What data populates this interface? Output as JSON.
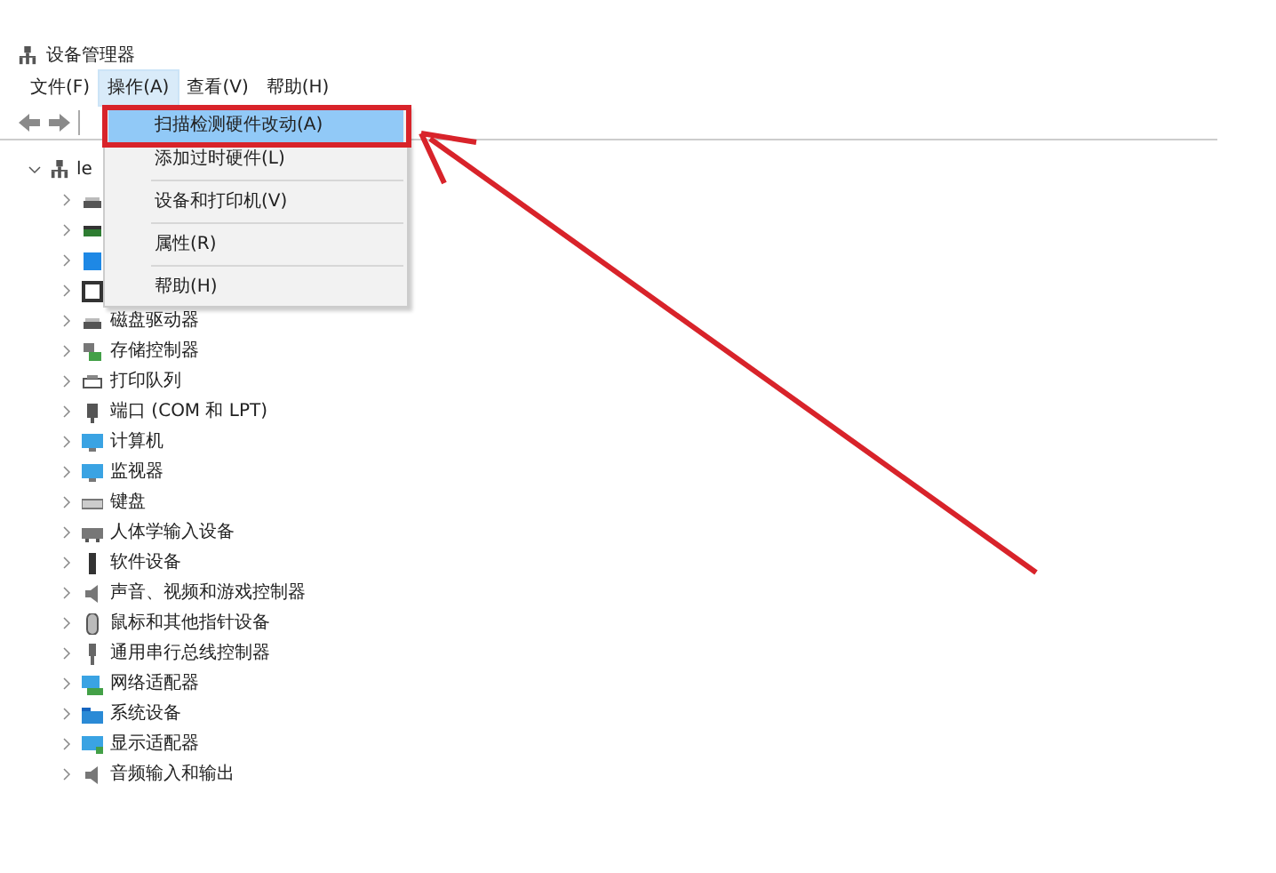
{
  "window": {
    "title": "设备管理器"
  },
  "menu_bar": [
    {
      "label": "文件(F)",
      "selected": false
    },
    {
      "label": "操作(A)",
      "selected": true
    },
    {
      "label": "查看(V)",
      "selected": false
    },
    {
      "label": "帮助(H)",
      "selected": false
    }
  ],
  "toolbar": [
    {
      "kind": "back",
      "disabled": false
    },
    {
      "kind": "forward",
      "disabled": false
    }
  ],
  "tree": {
    "label": "le",
    "expanded": true,
    "children": [
      {
        "kind": "drive"
      },
      {
        "kind": "battery"
      },
      {
        "kind": "bluetooth"
      },
      {
        "kind": "chip"
      },
      {
        "kind": "drive",
        "label": "磁盘驱动器"
      },
      {
        "kind": "storage",
        "label": "存储控制器"
      },
      {
        "kind": "printer",
        "label": "打印队列"
      },
      {
        "kind": "port",
        "label": "端口 (COM 和 LPT)"
      },
      {
        "kind": "monitor",
        "label": "计算机"
      },
      {
        "kind": "monitor",
        "label": "监视器"
      },
      {
        "kind": "keyboard",
        "label": "键盘"
      },
      {
        "kind": "hid",
        "label": "人体学输入设备"
      },
      {
        "kind": "device",
        "label": "软件设备"
      },
      {
        "kind": "audio",
        "label": "声音、视频和游戏控制器"
      },
      {
        "kind": "mouse",
        "label": "鼠标和其他指针设备"
      },
      {
        "kind": "usb",
        "label": "通用串行总线控制器"
      },
      {
        "kind": "network",
        "label": "网络适配器"
      },
      {
        "kind": "folder",
        "label": "系统设备"
      },
      {
        "kind": "display",
        "label": "显示适配器"
      },
      {
        "kind": "audio",
        "label": "音频输入和输出"
      }
    ]
  },
  "dropdown_menu": [
    {
      "label": "扫描检测硬件改动(A)",
      "selected": true
    },
    {
      "label": "添加过时硬件(L)",
      "selected": false
    },
    {
      "label": "设备和打印机(V)",
      "selected": false
    },
    {
      "label": "属性(R)",
      "selected": false
    },
    {
      "label": "帮助(H)",
      "selected": false
    }
  ]
}
